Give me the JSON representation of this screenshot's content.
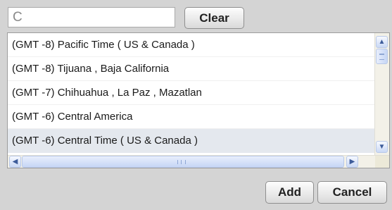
{
  "search": {
    "value": "C",
    "placeholder": ""
  },
  "buttons": {
    "clear": "Clear",
    "add": "Add",
    "cancel": "Cancel"
  },
  "timezones": [
    {
      "label": "(GMT -8) Pacific Time ( US & Canada )",
      "selected": false
    },
    {
      "label": "(GMT -8) Tijuana , Baja California",
      "selected": false
    },
    {
      "label": "(GMT -7) Chihuahua , La Paz , Mazatlan",
      "selected": false
    },
    {
      "label": "(GMT -6) Central America",
      "selected": false
    },
    {
      "label": "(GMT -6) Central Time ( US & Canada )",
      "selected": true
    }
  ],
  "icons": {
    "scroll_up": "up-arrow-icon",
    "scroll_down": "down-arrow-icon",
    "scroll_left": "left-arrow-icon",
    "scroll_right": "right-arrow-icon"
  },
  "colors": {
    "background": "#d4d4d4",
    "selected_row": "#e4e8ee",
    "scrollbar_accent": "#3d5c9a"
  }
}
